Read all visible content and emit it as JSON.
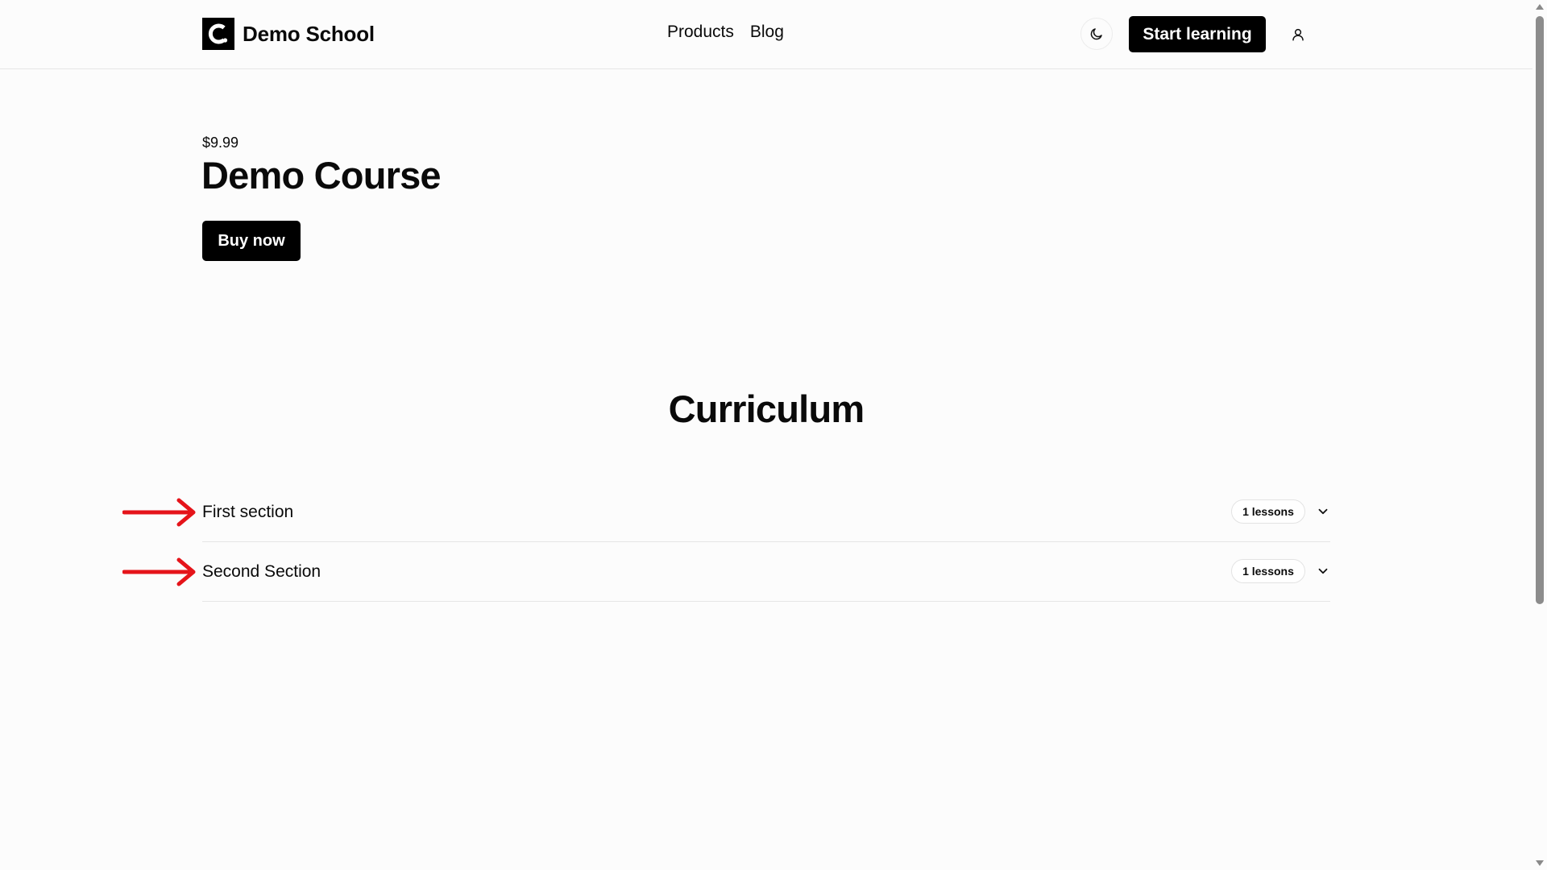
{
  "header": {
    "brand_name": "Demo School",
    "nav": [
      {
        "label": "Products"
      },
      {
        "label": "Blog"
      }
    ],
    "cta_label": "Start learning",
    "theme_icon": "moon-icon",
    "user_icon": "user-icon"
  },
  "course": {
    "price": "$9.99",
    "title": "Demo Course",
    "buy_label": "Buy now"
  },
  "curriculum": {
    "heading": "Curriculum",
    "sections": [
      {
        "title": "First section",
        "lessons": "1 lessons"
      },
      {
        "title": "Second Section",
        "lessons": "1 lessons"
      }
    ]
  },
  "colors": {
    "accent": "#000000",
    "background": "#fcfcfc",
    "annotation": "#e5141a"
  }
}
